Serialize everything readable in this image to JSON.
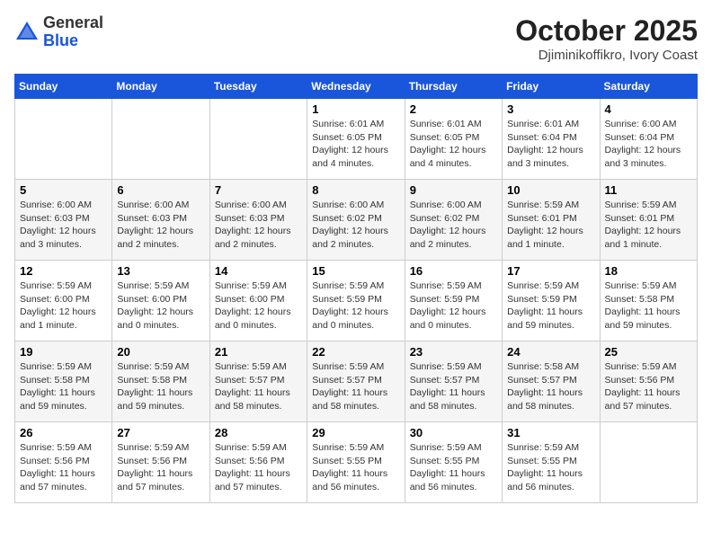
{
  "header": {
    "logo_general": "General",
    "logo_blue": "Blue",
    "month_title": "October 2025",
    "location": "Djiminikoffikro, Ivory Coast"
  },
  "weekdays": [
    "Sunday",
    "Monday",
    "Tuesday",
    "Wednesday",
    "Thursday",
    "Friday",
    "Saturday"
  ],
  "weeks": [
    [
      {
        "day": "",
        "info": ""
      },
      {
        "day": "",
        "info": ""
      },
      {
        "day": "",
        "info": ""
      },
      {
        "day": "1",
        "info": "Sunrise: 6:01 AM\nSunset: 6:05 PM\nDaylight: 12 hours and 4 minutes."
      },
      {
        "day": "2",
        "info": "Sunrise: 6:01 AM\nSunset: 6:05 PM\nDaylight: 12 hours and 4 minutes."
      },
      {
        "day": "3",
        "info": "Sunrise: 6:01 AM\nSunset: 6:04 PM\nDaylight: 12 hours and 3 minutes."
      },
      {
        "day": "4",
        "info": "Sunrise: 6:00 AM\nSunset: 6:04 PM\nDaylight: 12 hours and 3 minutes."
      }
    ],
    [
      {
        "day": "5",
        "info": "Sunrise: 6:00 AM\nSunset: 6:03 PM\nDaylight: 12 hours and 3 minutes."
      },
      {
        "day": "6",
        "info": "Sunrise: 6:00 AM\nSunset: 6:03 PM\nDaylight: 12 hours and 2 minutes."
      },
      {
        "day": "7",
        "info": "Sunrise: 6:00 AM\nSunset: 6:03 PM\nDaylight: 12 hours and 2 minutes."
      },
      {
        "day": "8",
        "info": "Sunrise: 6:00 AM\nSunset: 6:02 PM\nDaylight: 12 hours and 2 minutes."
      },
      {
        "day": "9",
        "info": "Sunrise: 6:00 AM\nSunset: 6:02 PM\nDaylight: 12 hours and 2 minutes."
      },
      {
        "day": "10",
        "info": "Sunrise: 5:59 AM\nSunset: 6:01 PM\nDaylight: 12 hours and 1 minute."
      },
      {
        "day": "11",
        "info": "Sunrise: 5:59 AM\nSunset: 6:01 PM\nDaylight: 12 hours and 1 minute."
      }
    ],
    [
      {
        "day": "12",
        "info": "Sunrise: 5:59 AM\nSunset: 6:00 PM\nDaylight: 12 hours and 1 minute."
      },
      {
        "day": "13",
        "info": "Sunrise: 5:59 AM\nSunset: 6:00 PM\nDaylight: 12 hours and 0 minutes."
      },
      {
        "day": "14",
        "info": "Sunrise: 5:59 AM\nSunset: 6:00 PM\nDaylight: 12 hours and 0 minutes."
      },
      {
        "day": "15",
        "info": "Sunrise: 5:59 AM\nSunset: 5:59 PM\nDaylight: 12 hours and 0 minutes."
      },
      {
        "day": "16",
        "info": "Sunrise: 5:59 AM\nSunset: 5:59 PM\nDaylight: 12 hours and 0 minutes."
      },
      {
        "day": "17",
        "info": "Sunrise: 5:59 AM\nSunset: 5:59 PM\nDaylight: 11 hours and 59 minutes."
      },
      {
        "day": "18",
        "info": "Sunrise: 5:59 AM\nSunset: 5:58 PM\nDaylight: 11 hours and 59 minutes."
      }
    ],
    [
      {
        "day": "19",
        "info": "Sunrise: 5:59 AM\nSunset: 5:58 PM\nDaylight: 11 hours and 59 minutes."
      },
      {
        "day": "20",
        "info": "Sunrise: 5:59 AM\nSunset: 5:58 PM\nDaylight: 11 hours and 59 minutes."
      },
      {
        "day": "21",
        "info": "Sunrise: 5:59 AM\nSunset: 5:57 PM\nDaylight: 11 hours and 58 minutes."
      },
      {
        "day": "22",
        "info": "Sunrise: 5:59 AM\nSunset: 5:57 PM\nDaylight: 11 hours and 58 minutes."
      },
      {
        "day": "23",
        "info": "Sunrise: 5:59 AM\nSunset: 5:57 PM\nDaylight: 11 hours and 58 minutes."
      },
      {
        "day": "24",
        "info": "Sunrise: 5:58 AM\nSunset: 5:57 PM\nDaylight: 11 hours and 58 minutes."
      },
      {
        "day": "25",
        "info": "Sunrise: 5:59 AM\nSunset: 5:56 PM\nDaylight: 11 hours and 57 minutes."
      }
    ],
    [
      {
        "day": "26",
        "info": "Sunrise: 5:59 AM\nSunset: 5:56 PM\nDaylight: 11 hours and 57 minutes."
      },
      {
        "day": "27",
        "info": "Sunrise: 5:59 AM\nSunset: 5:56 PM\nDaylight: 11 hours and 57 minutes."
      },
      {
        "day": "28",
        "info": "Sunrise: 5:59 AM\nSunset: 5:56 PM\nDaylight: 11 hours and 57 minutes."
      },
      {
        "day": "29",
        "info": "Sunrise: 5:59 AM\nSunset: 5:55 PM\nDaylight: 11 hours and 56 minutes."
      },
      {
        "day": "30",
        "info": "Sunrise: 5:59 AM\nSunset: 5:55 PM\nDaylight: 11 hours and 56 minutes."
      },
      {
        "day": "31",
        "info": "Sunrise: 5:59 AM\nSunset: 5:55 PM\nDaylight: 11 hours and 56 minutes."
      },
      {
        "day": "",
        "info": ""
      }
    ]
  ]
}
